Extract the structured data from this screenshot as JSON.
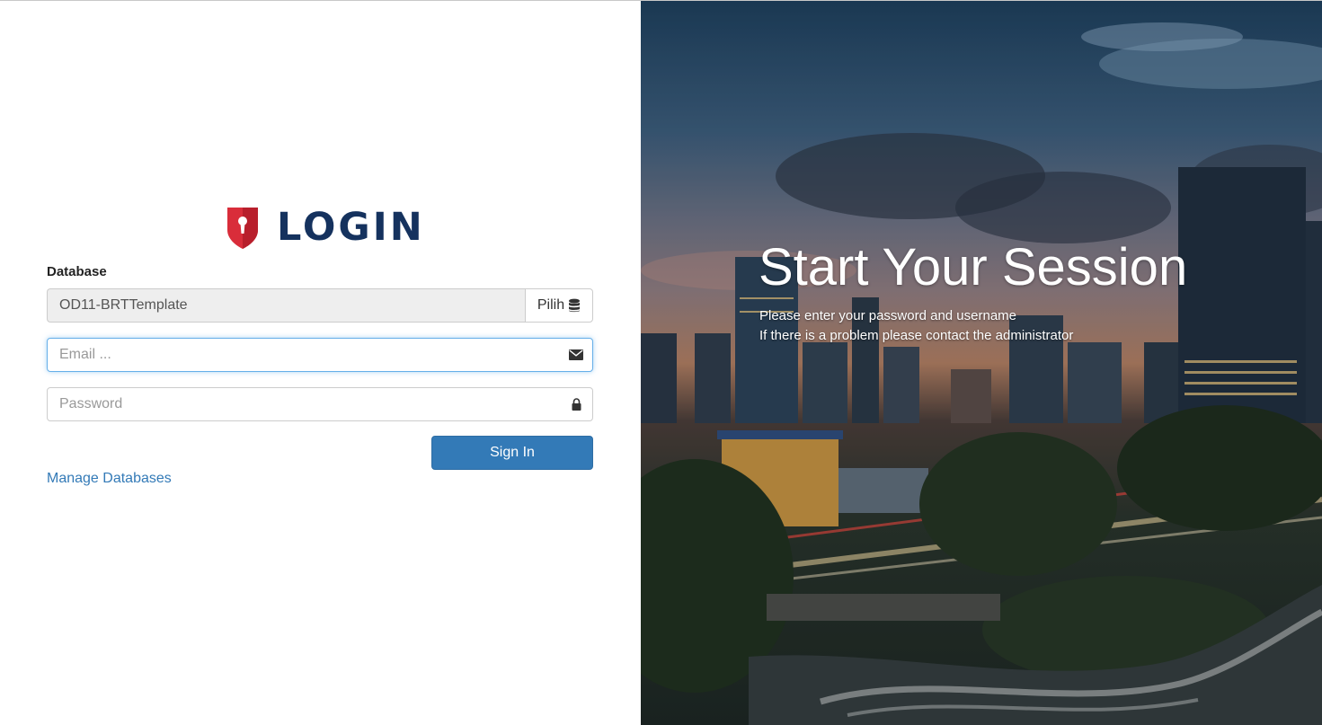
{
  "login": {
    "logo_text": "LOGIN",
    "database_label": "Database",
    "database_value": "OD11-BRTTemplate",
    "database_button_label": "Pilih",
    "email_placeholder": "Email ...",
    "password_placeholder": "Password",
    "signin_label": "Sign In",
    "manage_databases_label": "Manage Databases",
    "icons": {
      "logo": "shield-keyhole-icon",
      "database": "database-icon",
      "email": "envelope-icon",
      "password": "lock-icon"
    }
  },
  "hero": {
    "title": "Start Your Session",
    "line1": "Please enter your password and username",
    "line2": "If there is a problem please contact the administrator"
  },
  "colors": {
    "brand_navy": "#15325e",
    "shield_red": "#d92d3a",
    "primary_button": "#337ab7",
    "link": "#337ab7",
    "focus_border": "#66afe9"
  }
}
